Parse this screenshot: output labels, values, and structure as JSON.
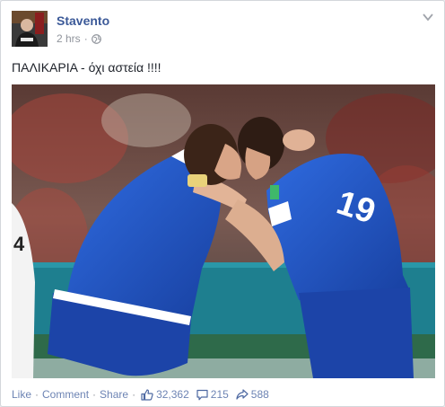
{
  "post": {
    "author": "Stavento",
    "time": "2 hrs",
    "dot": "·",
    "text": "ΠΑΛΙΚΑΡΙΑ - όχι αστεία !!!!",
    "image": {
      "shirt_number": "19"
    }
  },
  "actions": {
    "like_label": "Like",
    "comment_label": "Comment",
    "share_label": "Share",
    "separator": "·",
    "likes_count": "32,362",
    "comments_count": "215",
    "shares_count": "588"
  },
  "colors": {
    "link": "#3b5998",
    "muted": "#90949c",
    "action": "#6d84b4",
    "jersey": "#1f4fb8",
    "pitch_wall": "#1e7f8f"
  },
  "icons": [
    "globe-icon",
    "chevron-down-icon",
    "thumbs-up-icon",
    "comment-icon",
    "share-icon"
  ]
}
